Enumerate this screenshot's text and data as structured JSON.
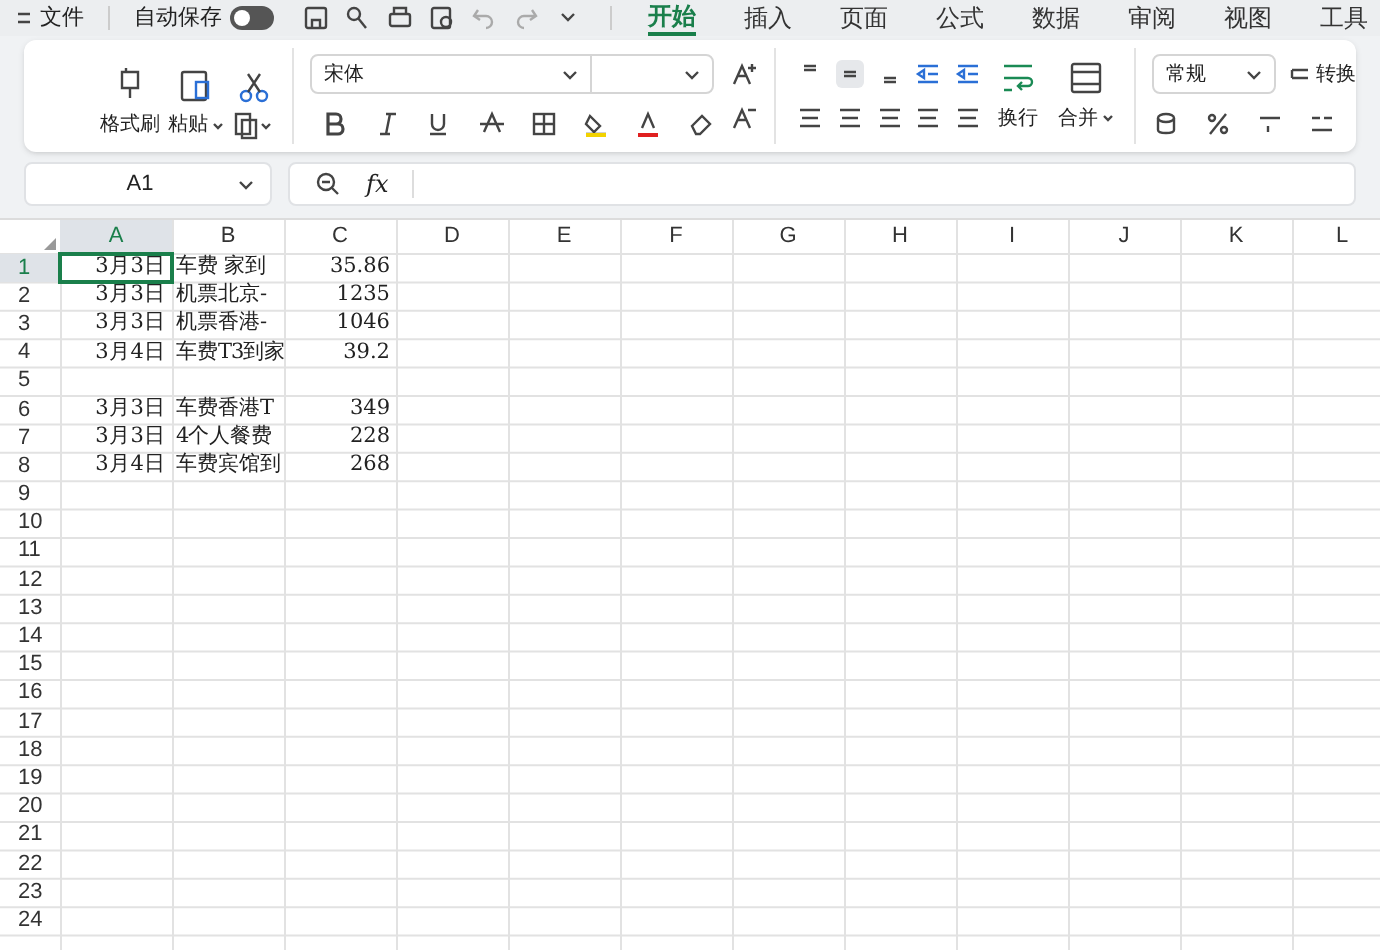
{
  "title_bar": {
    "menu": "文件",
    "autosave_label": "自动保存",
    "autosave_on": false,
    "tabs": [
      {
        "label": "开始",
        "selected": true
      },
      {
        "label": "插入",
        "selected": false
      },
      {
        "label": "页面",
        "selected": false
      },
      {
        "label": "公式",
        "selected": false
      },
      {
        "label": "数据",
        "selected": false
      },
      {
        "label": "审阅",
        "selected": false
      },
      {
        "label": "视图",
        "selected": false
      },
      {
        "label": "工具",
        "selected": false
      }
    ]
  },
  "ribbon": {
    "format_painter": "格式刷",
    "paste": "粘贴",
    "font_name": "宋体",
    "wrap": "换行",
    "merge": "合并",
    "number_format": "常规",
    "convert": "转换"
  },
  "formula_bar": {
    "name_box": "A1",
    "fx": "fx"
  },
  "sheet": {
    "columns": [
      {
        "label": "A",
        "selected": true
      },
      {
        "label": "B",
        "selected": false
      },
      {
        "label": "C",
        "selected": false
      },
      {
        "label": "D",
        "selected": false
      },
      {
        "label": "E",
        "selected": false
      },
      {
        "label": "F",
        "selected": false
      },
      {
        "label": "G",
        "selected": false
      },
      {
        "label": "H",
        "selected": false
      },
      {
        "label": "I",
        "selected": false
      },
      {
        "label": "J",
        "selected": false
      },
      {
        "label": "K",
        "selected": false
      },
      {
        "label": "L",
        "selected": false
      }
    ],
    "rows": [
      {
        "label": "1",
        "selected": true,
        "cells": [
          "3月3日",
          "车费 家到",
          "35.86"
        ]
      },
      {
        "label": "2",
        "selected": false,
        "cells": [
          "3月3日",
          "机票北京-",
          "1235"
        ]
      },
      {
        "label": "3",
        "selected": false,
        "cells": [
          "3月3日",
          "机票香港-",
          "1046"
        ]
      },
      {
        "label": "4",
        "selected": false,
        "cells": [
          "3月4日",
          "车费T3到家",
          "39.2"
        ]
      },
      {
        "label": "5",
        "selected": false
      },
      {
        "label": "6",
        "selected": false,
        "cells": [
          "3月3日",
          "车费香港T",
          "349"
        ]
      },
      {
        "label": "7",
        "selected": false,
        "cells": [
          "3月3日",
          "4个人餐费",
          "228"
        ]
      },
      {
        "label": "8",
        "selected": false,
        "cells": [
          "3月4日",
          "车费宾馆到",
          "268"
        ]
      },
      {
        "label": "9",
        "selected": false
      },
      {
        "label": "10",
        "selected": false
      },
      {
        "label": "11",
        "selected": false
      },
      {
        "label": "12",
        "selected": false
      },
      {
        "label": "13",
        "selected": false
      },
      {
        "label": "14",
        "selected": false
      },
      {
        "label": "15",
        "selected": false
      },
      {
        "label": "16",
        "selected": false
      },
      {
        "label": "17",
        "selected": false
      },
      {
        "label": "18",
        "selected": false
      },
      {
        "label": "19",
        "selected": false
      },
      {
        "label": "20",
        "selected": false
      },
      {
        "label": "21",
        "selected": false
      },
      {
        "label": "22",
        "selected": false
      },
      {
        "label": "23",
        "selected": false
      },
      {
        "label": "24",
        "selected": false
      }
    ]
  }
}
